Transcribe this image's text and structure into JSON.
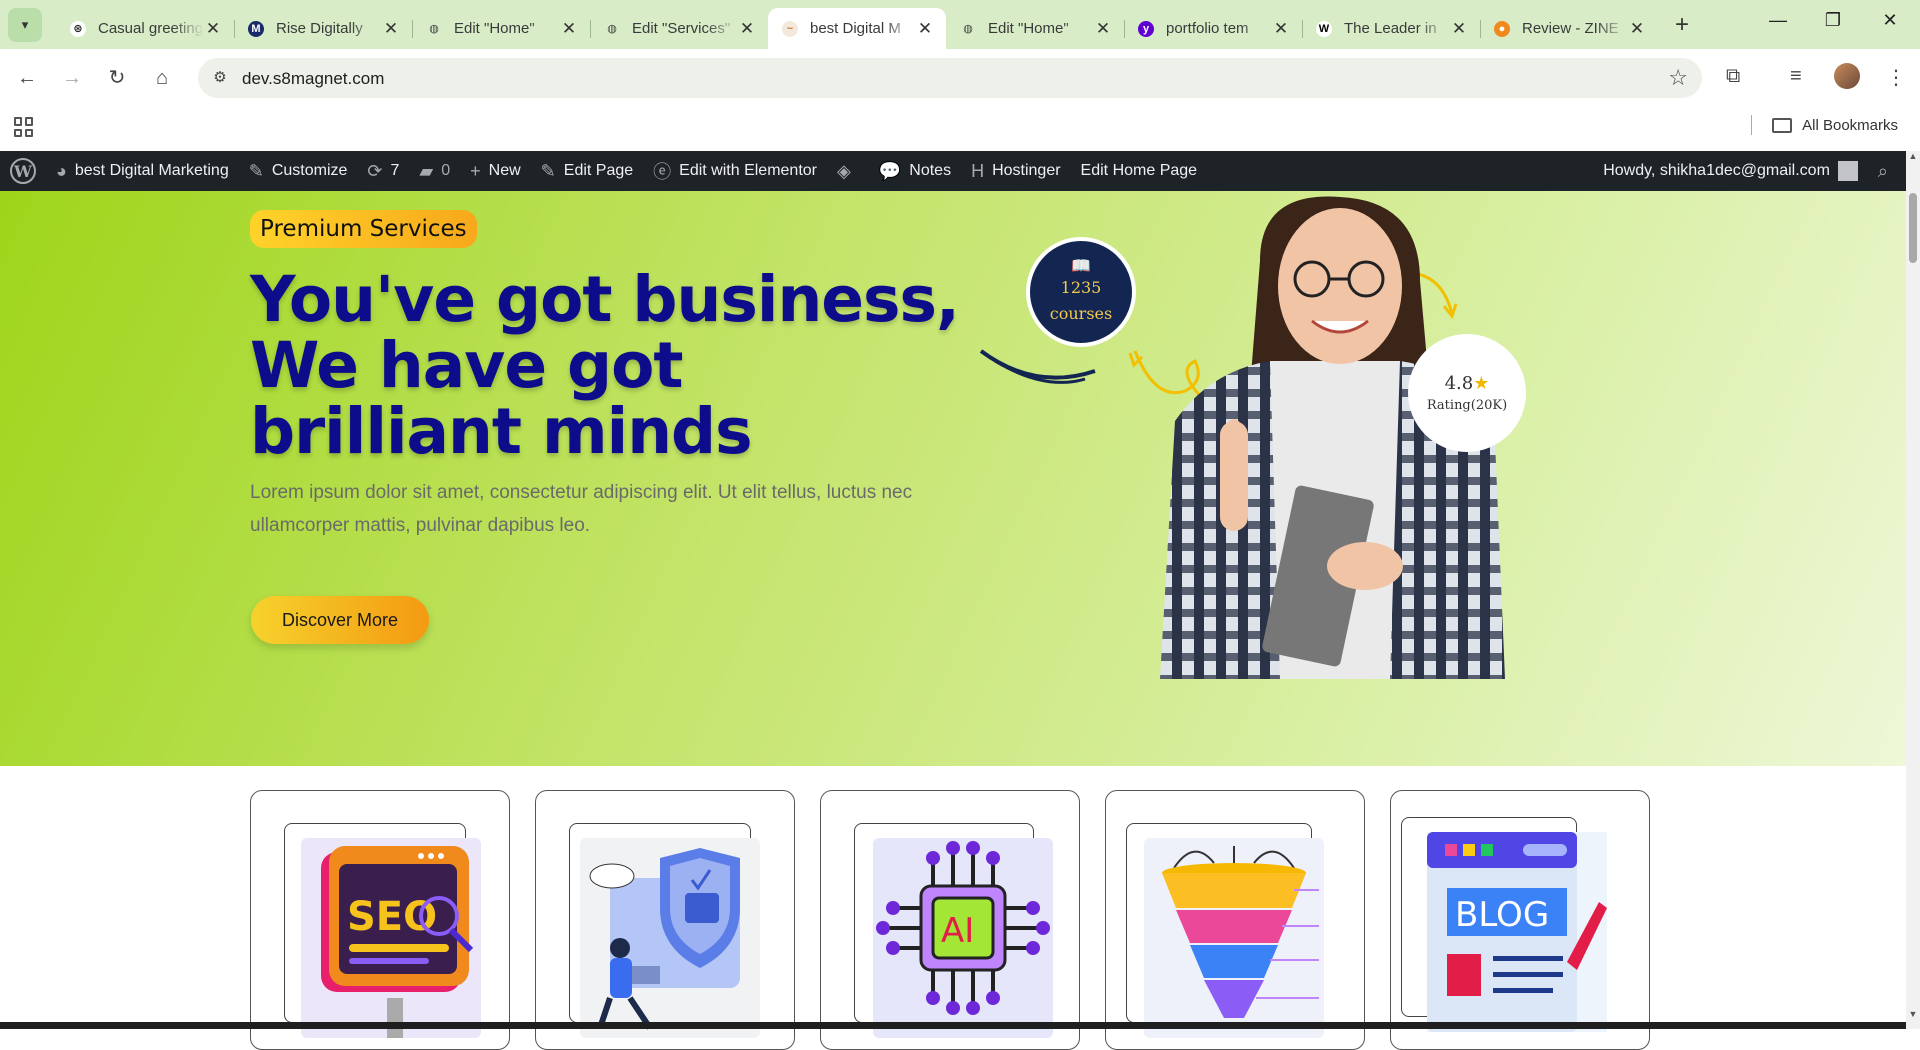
{
  "browser": {
    "tabs": [
      {
        "title": "Casual greeting",
        "icon": "openai-icon",
        "active": false
      },
      {
        "title": "Rise Digitally",
        "icon": "rise-icon",
        "active": false
      },
      {
        "title": "Edit \"Home\"",
        "icon": "globe-icon",
        "active": false
      },
      {
        "title": "Edit \"Services\"",
        "icon": "globe-icon",
        "active": false
      },
      {
        "title": "best Digital M",
        "icon": "site-icon",
        "active": true
      },
      {
        "title": "Edit \"Home\"",
        "icon": "globe-icon",
        "active": false
      },
      {
        "title": "portfolio tem",
        "icon": "yahoo-icon",
        "active": false
      },
      {
        "title": "The Leader in",
        "icon": "wix-icon",
        "active": false
      },
      {
        "title": "Review - ZINE",
        "icon": "review-icon",
        "active": false
      }
    ],
    "url": "dev.s8magnet.com",
    "bookmarks_label": "All Bookmarks"
  },
  "wp_admin": {
    "site_name": "best Digital Marketing",
    "customize": "Customize",
    "updates_count": "7",
    "comments_count": "0",
    "new": "New",
    "edit_page": "Edit Page",
    "edit_elementor": "Edit with Elementor",
    "notes": "Notes",
    "hostinger": "Hostinger",
    "edit_home": "Edit Home Page",
    "howdy": "Howdy, shikha1dec@gmail.com"
  },
  "hero": {
    "badge": "Premium Services",
    "headline": "You've got business, We have got brilliant minds",
    "subtext": "Lorem ipsum dolor sit amet, consectetur adipiscing elit. Ut elit tellus, luctus nec ullamcorper mattis, pulvinar dapibus leo.",
    "cta": "Discover More",
    "courses_count": "1235",
    "courses_label": "courses",
    "rating_value": "4.8",
    "rating_label": "Rating(20K)"
  },
  "cards": [
    {
      "name": "seo",
      "art_text": "SEO"
    },
    {
      "name": "security",
      "art_text": ""
    },
    {
      "name": "ai",
      "art_text": "AI"
    },
    {
      "name": "funnel",
      "art_text": ""
    },
    {
      "name": "blog",
      "art_text": "BLOG"
    }
  ],
  "colors": {
    "headline": "#0d0d8c",
    "hero_green": "#9ed51a",
    "wp_bar": "#1d2327",
    "cta_gradient_start": "#f6d22c",
    "cta_gradient_end": "#f39a12"
  }
}
